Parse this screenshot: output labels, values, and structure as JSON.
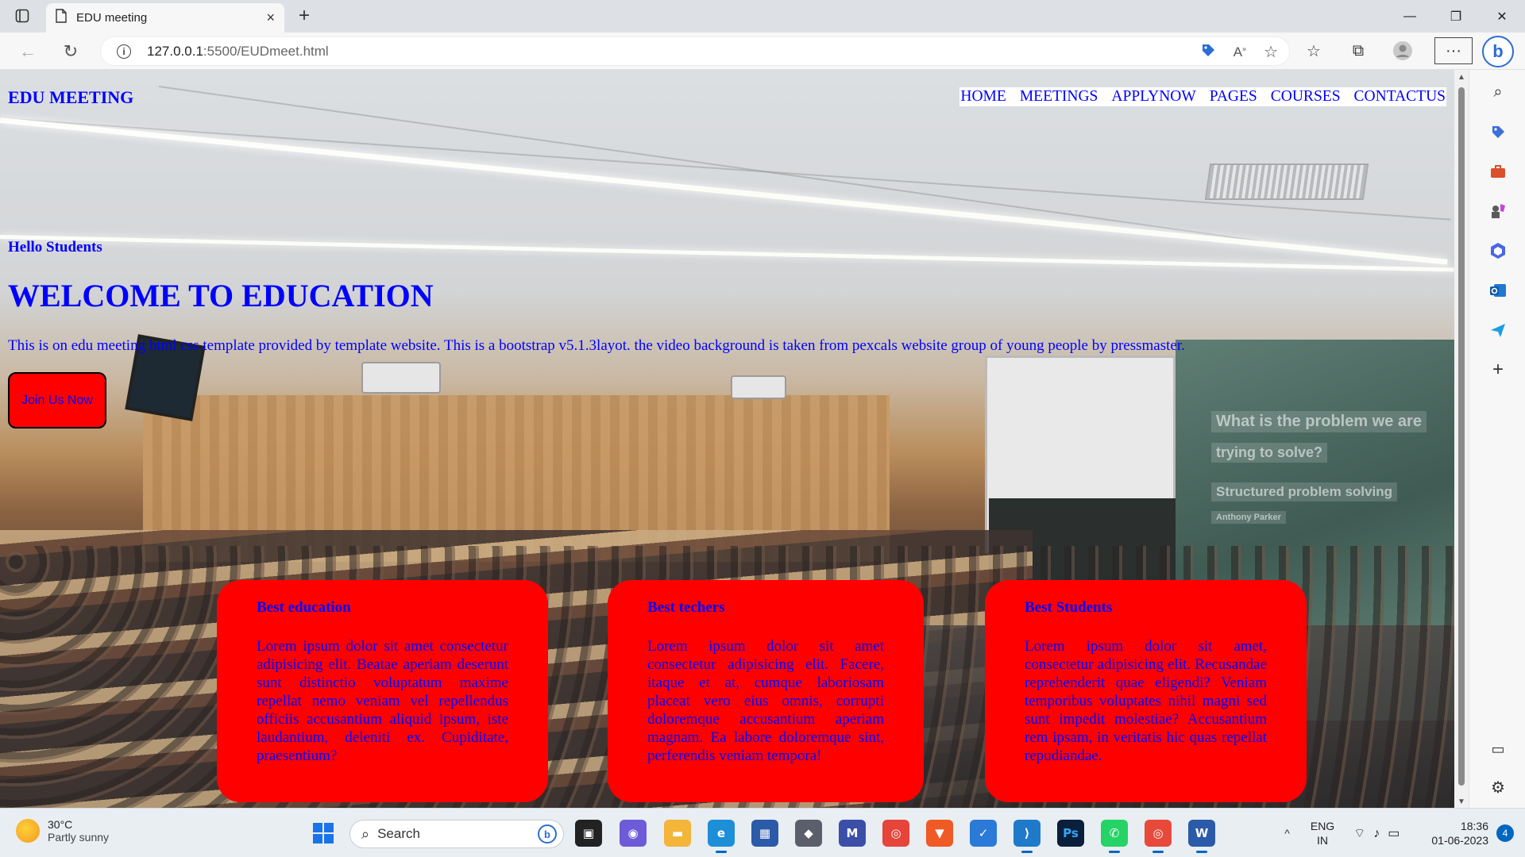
{
  "browser": {
    "tab_title": "EDU meeting",
    "tab_close": "×",
    "new_tab": "+",
    "window_controls": {
      "minimize": "—",
      "restore": "❐",
      "close": "✕"
    },
    "url_host": "127.0.0.1",
    "url_path": ":5500/EUDmeet.html",
    "nav": {
      "back": "←",
      "reload": "↻"
    },
    "more_label": "···"
  },
  "site": {
    "logo": "EDU MEETING",
    "nav_items": [
      "HOME",
      "MEETINGS",
      "APPLYNOW",
      "PAGES",
      "COURSES",
      "CONTACTUS"
    ],
    "hero": {
      "greeting": "Hello Students",
      "title": "WELCOME TO EDUCATION",
      "description": "This is on edu meeting html css template provided by template website. This is a bootstrap v5.1.3layot. the video background is taken from pexcals website group of young people by pressmaster.",
      "cta": "Join Us Now"
    },
    "cards": [
      {
        "title": "Best education",
        "body": "Lorem ipsum dolor sit amet consectetur adipisicing elit. Beatae aperiam deserunt sunt distinctio voluptatum maxime repellat nemo veniam vel repellendus officiis accusantium aliquid ipsum, iste laudantium, deleniti ex. Cupiditate, praesentium?"
      },
      {
        "title": "Best techers",
        "body": "Lorem ipsum dolor sit amet consectetur adipisicing elit. Facere, itaque et at, cumque laboriosam placeat vero eius omnis, corrupti doloremque accusantium aperiam magnam. Ea labore doloremque sint, perferendis veniam tempora!"
      },
      {
        "title": "Best Students",
        "body": "Lorem ipsum dolor sit amet, consectetur adipisicing elit. Recusandae reprehenderit quae eligendi? Veniam temporibus voluptates nihil magni sed sunt impedit molestiae? Accusantium rem ipsam, in veritatis hic quas repellat repudiandae."
      }
    ],
    "background_screen_text": [
      "What is the problem we are",
      "trying to solve?",
      "Structured problem solving",
      "Anthony Parker"
    ]
  },
  "taskbar": {
    "weather_temp": "30°C",
    "weather_condition": "Partly sunny",
    "search_placeholder": "Search",
    "language_line1": "ENG",
    "language_line2": "IN",
    "time": "18:36",
    "date": "01-06-2023",
    "notification_count": "4",
    "tray_chevron": "^"
  },
  "colors": {
    "text_blue": "#0000ff",
    "card_red": "#ff0000",
    "nav_bg": "#ffffff"
  }
}
